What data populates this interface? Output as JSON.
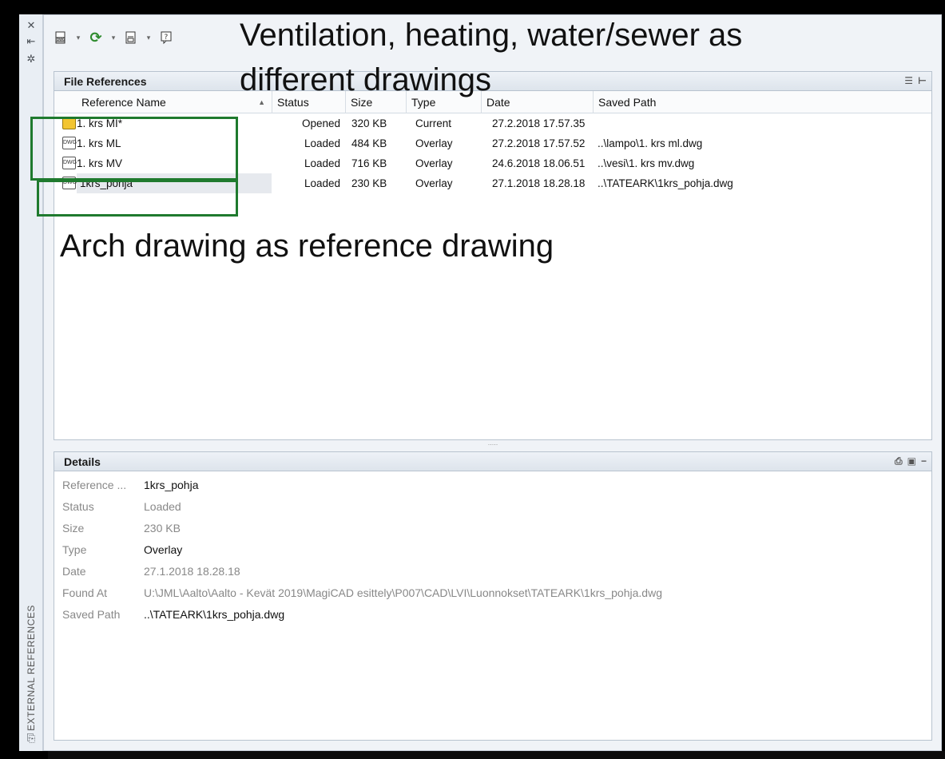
{
  "side_strip": {
    "title": "EXTERNAL REFERENCES",
    "icons": [
      "close-icon",
      "pin-icon",
      "settings-icon",
      "palette-menu-icon"
    ]
  },
  "toolbar": {
    "icons": [
      "attach-dwg-icon",
      "refresh-icon",
      "change-path-icon",
      "help-icon"
    ]
  },
  "file_references": {
    "title": "File References",
    "columns": [
      "Reference Name",
      "Status",
      "Size",
      "Type",
      "Date",
      "Saved Path"
    ],
    "rows": [
      {
        "name": "1. krs MI*",
        "status": "Opened",
        "size": "320 KB",
        "type": "Current",
        "date": "27.2.2018 17.57.35",
        "path": ""
      },
      {
        "name": "1. krs ML",
        "status": "Loaded",
        "size": "484 KB",
        "type": "Overlay",
        "date": "27.2.2018 17.57.52",
        "path": "..\\lampo\\1. krs ml.dwg"
      },
      {
        "name": "1. krs MV",
        "status": "Loaded",
        "size": "716 KB",
        "type": "Overlay",
        "date": "24.6.2018 18.06.51",
        "path": "..\\vesi\\1. krs mv.dwg"
      },
      {
        "name": "1krs_pohja",
        "status": "Loaded",
        "size": "230 KB",
        "type": "Overlay",
        "date": "27.1.2018 18.28.18",
        "path": "..\\TATEARK\\1krs_pohja.dwg"
      }
    ]
  },
  "details": {
    "title": "Details",
    "fields": [
      {
        "label": "Reference ...",
        "value": "1krs_pohja"
      },
      {
        "label": "Status",
        "value": "Loaded"
      },
      {
        "label": "Size",
        "value": "230 KB"
      },
      {
        "label": "Type",
        "value": "Overlay"
      },
      {
        "label": "Date",
        "value": "27.1.2018 18.28.18"
      },
      {
        "label": "Found At",
        "value": "U:\\JML\\Aalto\\Aalto - Kevät 2019\\MagiCAD esittely\\P007\\CAD\\LVI\\Luonnokset\\TATEARK\\1krs_pohja.dwg"
      },
      {
        "label": "Saved Path",
        "value": "..\\TATEARK\\1krs_pohja.dwg"
      }
    ]
  },
  "annotations": {
    "top_line1": "Ventilation, heating, water/sewer as",
    "top_line2": "different drawings",
    "middle": "Arch drawing as reference drawing"
  },
  "colors": {
    "annotation_box": "#1f7a2e",
    "refresh_icon": "#2e8b2e",
    "current_icon": "#f3c531"
  }
}
